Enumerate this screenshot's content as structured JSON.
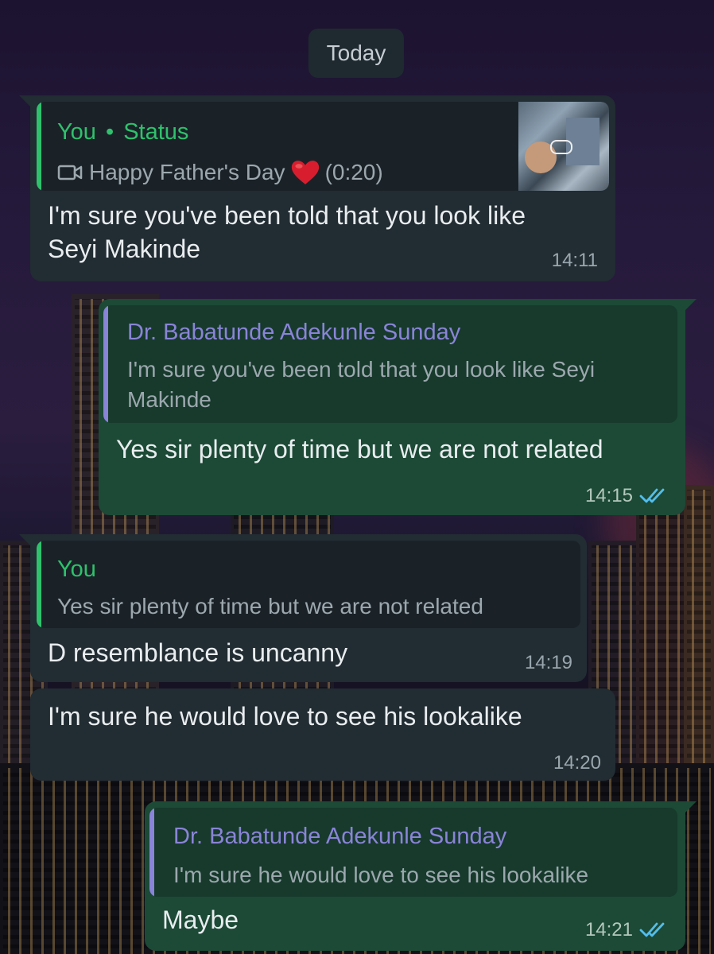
{
  "date_label": "Today",
  "colors": {
    "incoming_bubble": "#222c33",
    "outgoing_bubble": "#1c4a36",
    "you_accent": "#2fc16c",
    "contact_accent": "#8a84d8",
    "read_ticks": "#53bdeb"
  },
  "messages": [
    {
      "direction": "incoming",
      "quote": {
        "author": "You",
        "separator": "•",
        "source": "Status",
        "media_icon": "video-icon",
        "caption": "Happy Father's Day",
        "emoji": "red-heart-icon",
        "duration": "(0:20)"
      },
      "text": "I'm sure you've been told that you look like Seyi Makinde",
      "time": "14:11"
    },
    {
      "direction": "outgoing",
      "quote": {
        "author": "Dr. Babatunde Adekunle Sunday",
        "text": "I'm sure you've been told that you look like Seyi Makinde"
      },
      "text": "Yes sir plenty of time but we are not related",
      "time": "14:15",
      "status_icon": "double-check-read-icon"
    },
    {
      "direction": "incoming",
      "quote": {
        "author": "You",
        "text": "Yes sir plenty of time but we are not related"
      },
      "text": "D resemblance is uncanny",
      "time": "14:19"
    },
    {
      "direction": "incoming",
      "text": "I'm sure he would love to see his lookalike",
      "time": "14:20"
    },
    {
      "direction": "outgoing",
      "quote": {
        "author": "Dr. Babatunde Adekunle Sunday",
        "text": "I'm sure he would love to see his lookalike"
      },
      "text": "Maybe",
      "time": "14:21",
      "status_icon": "double-check-read-icon"
    }
  ]
}
